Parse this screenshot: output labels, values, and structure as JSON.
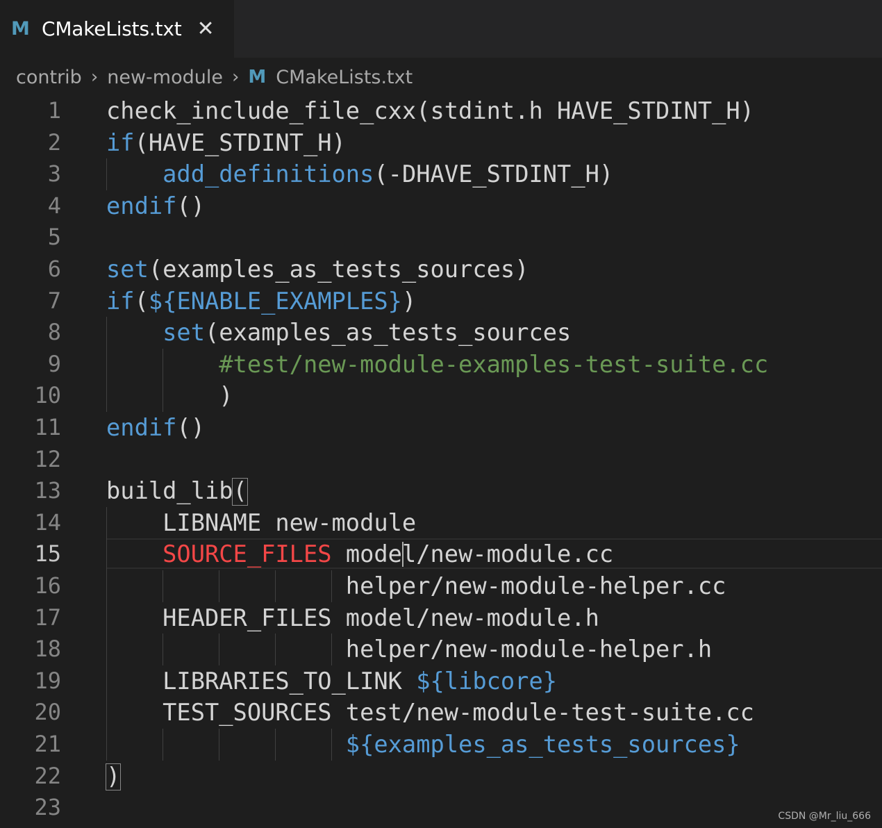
{
  "tab": {
    "icon": "M",
    "title": "CMakeLists.txt",
    "close": "✕"
  },
  "breadcrumb": {
    "items": [
      "contrib",
      "new-module",
      "CMakeLists.txt"
    ],
    "separator": "›",
    "file_icon": "M"
  },
  "editor": {
    "line_numbers": [
      "1",
      "2",
      "3",
      "4",
      "5",
      "6",
      "7",
      "8",
      "9",
      "10",
      "11",
      "12",
      "13",
      "14",
      "15",
      "16",
      "17",
      "18",
      "19",
      "20",
      "21",
      "22",
      "23"
    ],
    "active_line": "15",
    "lines": [
      [
        {
          "t": "check_include_file_cxx(stdint.h HAVE_STDINT_H)",
          "c": "plain"
        }
      ],
      [
        {
          "t": "if",
          "c": "kw"
        },
        {
          "t": "(HAVE_STDINT_H)",
          "c": "plain"
        }
      ],
      [
        {
          "t": "    ",
          "c": "plain"
        },
        {
          "t": "add_definitions",
          "c": "kw"
        },
        {
          "t": "(-DHAVE_STDINT_H)",
          "c": "plain"
        }
      ],
      [
        {
          "t": "endif",
          "c": "kw"
        },
        {
          "t": "()",
          "c": "plain"
        }
      ],
      [],
      [
        {
          "t": "set",
          "c": "kw"
        },
        {
          "t": "(examples_as_tests_sources)",
          "c": "plain"
        }
      ],
      [
        {
          "t": "if",
          "c": "kw"
        },
        {
          "t": "(",
          "c": "plain"
        },
        {
          "t": "${ENABLE_EXAMPLES}",
          "c": "kw"
        },
        {
          "t": ")",
          "c": "plain"
        }
      ],
      [
        {
          "t": "    ",
          "c": "plain"
        },
        {
          "t": "set",
          "c": "kw"
        },
        {
          "t": "(examples_as_tests_sources",
          "c": "plain"
        }
      ],
      [
        {
          "t": "        ",
          "c": "plain"
        },
        {
          "t": "#test/new-module-examples-test-suite.cc",
          "c": "cmt"
        }
      ],
      [
        {
          "t": "        )",
          "c": "plain"
        }
      ],
      [
        {
          "t": "endif",
          "c": "kw"
        },
        {
          "t": "()",
          "c": "plain"
        }
      ],
      [],
      [
        {
          "t": "build_lib(",
          "c": "plain"
        }
      ],
      [
        {
          "t": "    LIBNAME new-module",
          "c": "plain"
        }
      ],
      [
        {
          "t": "    ",
          "c": "plain"
        },
        {
          "t": "SOURCE_FILES",
          "c": "red"
        },
        {
          "t": " model/new-module.cc",
          "c": "plain"
        }
      ],
      [
        {
          "t": "                 helper/new-module-helper.cc",
          "c": "plain"
        }
      ],
      [
        {
          "t": "    HEADER_FILES model/new-module.h",
          "c": "plain"
        }
      ],
      [
        {
          "t": "                 helper/new-module-helper.h",
          "c": "plain"
        }
      ],
      [
        {
          "t": "    LIBRARIES_TO_LINK ",
          "c": "plain"
        },
        {
          "t": "${libcore}",
          "c": "kw"
        }
      ],
      [
        {
          "t": "    TEST_SOURCES test/new-module-test-suite.cc",
          "c": "plain"
        }
      ],
      [
        {
          "t": "                 ",
          "c": "plain"
        },
        {
          "t": "${examples_as_tests_sources}",
          "c": "kw"
        }
      ],
      [
        {
          "t": ")",
          "c": "plain"
        }
      ],
      []
    ]
  },
  "watermark": "CSDN @Mr_liu_666"
}
